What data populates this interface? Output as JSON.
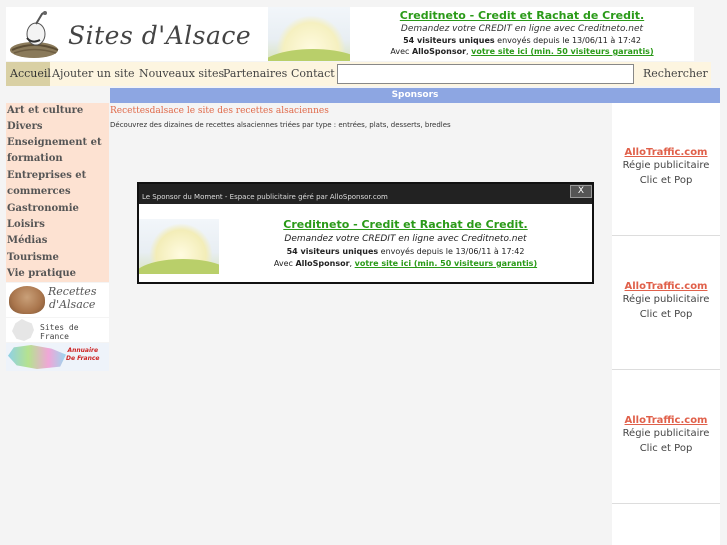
{
  "header": {
    "logo_text": "Sites d'Alsace",
    "ad": {
      "title": "Creditneto - Credit et Rachat de Credit.",
      "subtitle": "Demandez votre CREDIT en ligne avec Creditneto.net",
      "visitors_bold": "54 visiteurs uniques",
      "visitors_rest": " envoyés depuis le 13/06/11 à 17:42",
      "with_prefix": "Avec ",
      "with_brand": "AlloSponsor",
      "with_sep": ", ",
      "link": "votre site ici (min. 50 visiteurs garantis)"
    }
  },
  "nav": {
    "home": "Accueil",
    "add_site": "Ajouter un site",
    "new_sites": "Nouveaux sites",
    "partners": "Partenaires",
    "contact": "Contact",
    "search_value": "",
    "search_button": "Rechercher"
  },
  "sponsors_bar": "Sponsors",
  "sidebar": {
    "categories": [
      "Art et culture",
      "Divers",
      "Enseignement et",
      "formation",
      "Entreprises et",
      "commerces",
      "Gastronomie",
      "Loisirs",
      "Médias",
      "Tourisme",
      "Vie pratique"
    ],
    "banner_recettes_line1": "Recettes",
    "banner_recettes_line2": "d'Alsace",
    "banner_sites_france": "Sites de France",
    "banner_annuaire_line1": "Annuaire",
    "banner_annuaire_line2": "De France"
  },
  "content": {
    "title": "Recettesdalsace le site des recettes alsaciennes",
    "description": "Découvrez des dizaines de recettes alsaciennes triées par type : entrées, plats, desserts, bredles"
  },
  "right_ads": [
    {
      "title": "AlloTraffic.com",
      "line1": "Régie publicitaire",
      "line2": "Clic et Pop"
    },
    {
      "title": "AlloTraffic.com",
      "line1": "Régie publicitaire",
      "line2": "Clic et Pop"
    },
    {
      "title": "AlloTraffic.com",
      "line1": "Régie publicitaire",
      "line2": "Clic et Pop"
    }
  ],
  "popup": {
    "header": "Le Sponsor du Moment - Espace publicitaire géré par AlloSponsor.com",
    "close": "X",
    "ad": {
      "title": "Creditneto - Credit et Rachat de Credit.",
      "subtitle": "Demandez votre CREDIT en ligne avec Creditneto.net",
      "visitors_bold": "54 visiteurs uniques",
      "visitors_rest": " envoyés depuis le 13/06/11 à 17:42",
      "with_prefix": "Avec ",
      "with_brand": "AlloSponsor",
      "with_sep": ", ",
      "link": "votre site ici (min. 50 visiteurs garantis)"
    }
  }
}
